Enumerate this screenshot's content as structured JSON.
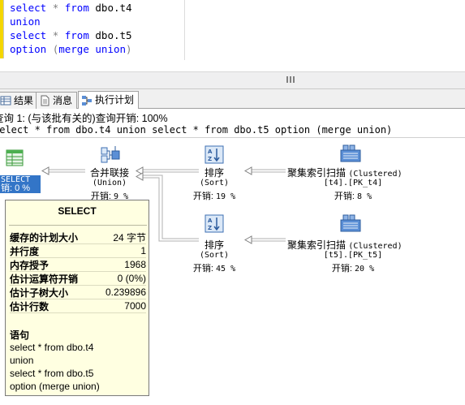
{
  "editor": {
    "lines": [
      {
        "kw1": "select",
        "op": "*",
        "kw2": "from",
        "rest": "dbo.t4"
      },
      {
        "kw1": "union"
      },
      {
        "kw1": "select",
        "op": "*",
        "kw2": "from",
        "rest": "dbo.t5"
      },
      {
        "kw1": "option",
        "paren_open": "(",
        "kw2": "merge",
        "kw3": "union",
        "paren_close": ")"
      }
    ]
  },
  "tabs": [
    {
      "label": "结果",
      "icon": "grid-icon"
    },
    {
      "label": "消息",
      "icon": "document-icon"
    },
    {
      "label": "执行计划",
      "icon": "execution-plan-icon",
      "active": true
    }
  ],
  "plan": {
    "query_header": "查询 1: (与该批有关的)查询开销: 100%",
    "query_text": "select * from dbo.t4 union select * from dbo.t5 option (merge union)",
    "select_node": {
      "label": "SELECT",
      "cost": "销: 0 %"
    },
    "merge_node": {
      "name": "合并联接",
      "sub": "(Union)",
      "cost_label": "开销:",
      "cost_value": "9 %"
    },
    "sort_top": {
      "name": "排序",
      "sub": "(Sort)",
      "cost_label": "开销:",
      "cost_value": "19 %"
    },
    "sort_bottom": {
      "name": "排序",
      "sub": "(Sort)",
      "cost_label": "开销:",
      "cost_value": "45 %"
    },
    "scan_top": {
      "name": "聚集索引扫描",
      "sub_paren": "(Clustered)",
      "object": "[t4].[PK_t4]",
      "cost_label": "开销:",
      "cost_value": "8 %"
    },
    "scan_bottom": {
      "name": "聚集索引扫描",
      "sub_paren": "(Clustered)",
      "object": "[t5].[PK_t5]",
      "cost_label": "开销:",
      "cost_value": "20 %"
    }
  },
  "tooltip": {
    "title": "SELECT",
    "rows": [
      {
        "k": "缓存的计划大小",
        "v": "24 字节"
      },
      {
        "k": "并行度",
        "v": "1"
      },
      {
        "k": "内存授予",
        "v": "1968"
      },
      {
        "k": "估计运算符开销",
        "v": "0 (0%)"
      },
      {
        "k": "估计子树大小",
        "v": "0.239896"
      },
      {
        "k": "估计行数",
        "v": "7000"
      }
    ],
    "statement_title": "语句",
    "statement_lines": [
      "select * from dbo.t4",
      "union",
      "select * from dbo.t5",
      "option (merge union)"
    ]
  },
  "colors": {
    "keyword": "#0000ff",
    "operator": "#808080",
    "selection": "#3375c7",
    "tooltip_bg": "#ffffe1",
    "gutter": "#f4d600"
  }
}
